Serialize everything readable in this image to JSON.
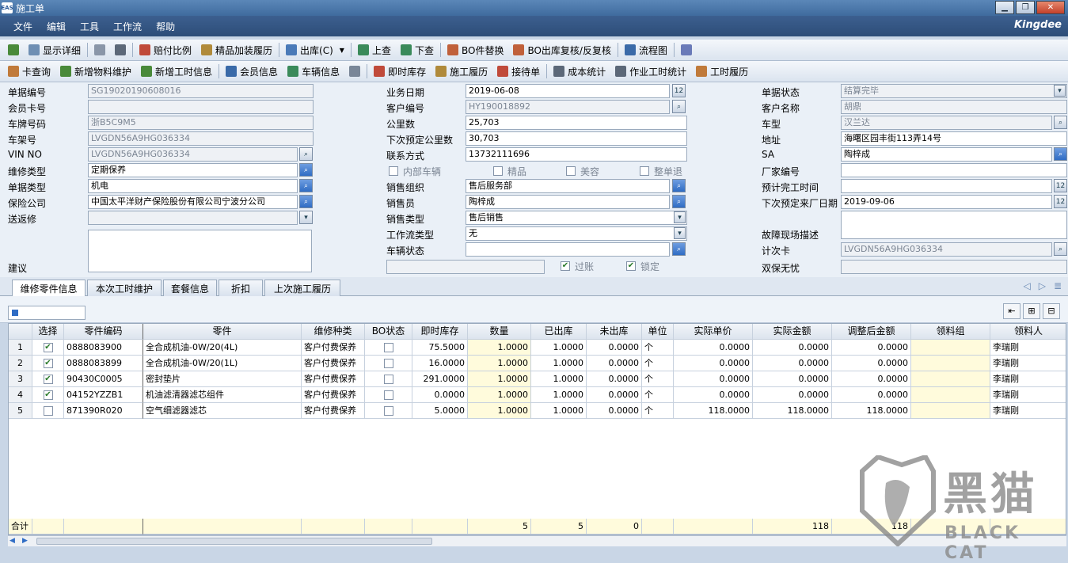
{
  "window": {
    "title": "施工单",
    "app_icon": "EAS",
    "controls": [
      "minimize-icon",
      "restore-icon",
      "close-icon"
    ]
  },
  "menu": [
    "文件",
    "编辑",
    "工具",
    "工作流",
    "帮助"
  ],
  "brand": "Kingdee",
  "toolbar1": [
    "显示详细",
    "赔付比例",
    "精品加装履历",
    "出库(C)",
    "上查",
    "下查",
    "BO件替换",
    "BO出库复核/反复核",
    "流程图"
  ],
  "toolbar2": [
    "卡查询",
    "新增物料维护",
    "新增工时信息",
    "会员信息",
    "车辆信息",
    "即时库存",
    "施工履历",
    "接待单",
    "成本统计",
    "作业工时统计",
    "工时履历"
  ],
  "form": {
    "left": [
      {
        "label": "单据编号",
        "value": "SG19020190608016"
      },
      {
        "label": "会员卡号",
        "value": ""
      },
      {
        "label": "车牌号码",
        "value": "浙B5C9M5"
      },
      {
        "label": "车架号",
        "value": "LVGDN56A9HG036334"
      },
      {
        "label": "VIN NO",
        "value": "LVGDN56A9HG036334"
      },
      {
        "label": "维修类型",
        "value": "定期保养"
      },
      {
        "label": "单据类型",
        "value": "机电"
      },
      {
        "label": "保险公司",
        "value": "中国太平洋财产保险股份有限公司宁波分公司"
      },
      {
        "label": "送返修",
        "value": ""
      },
      {
        "label": "建议",
        "value": ""
      }
    ],
    "middle": [
      {
        "label": "业务日期",
        "value": "2019-06-08"
      },
      {
        "label": "客户编号",
        "value": "HY190018892"
      },
      {
        "label": "公里数",
        "value": "25,703"
      },
      {
        "label": "下次预定公里数",
        "value": "30,703"
      },
      {
        "label": "联系方式",
        "value": "13732111696"
      },
      {
        "label": "销售组织",
        "value": "售后服务部"
      },
      {
        "label": "销售员",
        "value": "陶梓成"
      },
      {
        "label": "销售类型",
        "value": "售后销售"
      },
      {
        "label": "工作流类型",
        "value": "无"
      },
      {
        "label": "车辆状态",
        "value": ""
      }
    ],
    "checks1": [
      {
        "label": "内部车辆",
        "checked": false
      },
      {
        "label": "精品",
        "checked": false
      },
      {
        "label": "美容",
        "checked": false
      },
      {
        "label": "整单退",
        "checked": false
      }
    ],
    "checks2": [
      {
        "label": "过账",
        "checked": true
      },
      {
        "label": "锁定",
        "checked": true
      }
    ],
    "right": [
      {
        "label": "单据状态",
        "value": "结算完毕"
      },
      {
        "label": "客户名称",
        "value": "胡鼎"
      },
      {
        "label": "车型",
        "value": "汉兰达"
      },
      {
        "label": "地址",
        "value": "海曙区园丰街113弄14号"
      },
      {
        "label": "SA",
        "value": "陶梓成"
      },
      {
        "label": "厂家编号",
        "value": ""
      },
      {
        "label": "预计完工时间",
        "value": ""
      },
      {
        "label": "下次预定来厂日期",
        "value": "2019-09-06"
      },
      {
        "label": "故障现场描述",
        "value": ""
      },
      {
        "label": "计次卡",
        "value": "LVGDN56A9HG036334"
      },
      {
        "label": "双保无忧",
        "value": ""
      }
    ]
  },
  "tabs": [
    "维修零件信息",
    "本次工时维护",
    "套餐信息",
    "折扣",
    "上次施工履历"
  ],
  "grid": {
    "columns": [
      "选择",
      "零件编码",
      "零件",
      "维修种类",
      "BO状态",
      "即时库存",
      "数量",
      "已出库",
      "未出库",
      "单位",
      "实际单价",
      "实际金额",
      "调整后金额",
      "领料组",
      "领料人"
    ],
    "rows": [
      {
        "n": "1",
        "sel": true,
        "code": "0888083900",
        "part": "全合成机油-0W/20(4L)",
        "type": "客户付费保养",
        "bo": false,
        "stock": "75.5000",
        "qty": "1.0000",
        "out": "1.0000",
        "notout": "0.0000",
        "unit": "个",
        "price": "0.0000",
        "amount": "0.0000",
        "adj": "0.0000",
        "group": "",
        "person": "李瑞刚"
      },
      {
        "n": "2",
        "sel": true,
        "code": "0888083899",
        "part": "全合成机油-0W/20(1L)",
        "type": "客户付费保养",
        "bo": false,
        "stock": "16.0000",
        "qty": "1.0000",
        "out": "1.0000",
        "notout": "0.0000",
        "unit": "个",
        "price": "0.0000",
        "amount": "0.0000",
        "adj": "0.0000",
        "group": "",
        "person": "李瑞刚"
      },
      {
        "n": "3",
        "sel": true,
        "code": "90430C0005",
        "part": "密封垫片",
        "type": "客户付费保养",
        "bo": false,
        "stock": "291.0000",
        "qty": "1.0000",
        "out": "1.0000",
        "notout": "0.0000",
        "unit": "个",
        "price": "0.0000",
        "amount": "0.0000",
        "adj": "0.0000",
        "group": "",
        "person": "李瑞刚"
      },
      {
        "n": "4",
        "sel": true,
        "code": "04152YZZB1",
        "part": "机油滤清器滤芯组件",
        "type": "客户付费保养",
        "bo": false,
        "stock": "0.0000",
        "qty": "1.0000",
        "out": "1.0000",
        "notout": "0.0000",
        "unit": "个",
        "price": "0.0000",
        "amount": "0.0000",
        "adj": "0.0000",
        "group": "",
        "person": "李瑞刚"
      },
      {
        "n": "5",
        "sel": false,
        "code": "871390R020",
        "part": "空气细滤器滤芯",
        "type": "客户付费保养",
        "bo": false,
        "stock": "5.0000",
        "qty": "1.0000",
        "out": "1.0000",
        "notout": "0.0000",
        "unit": "个",
        "price": "118.0000",
        "amount": "118.0000",
        "adj": "118.0000",
        "group": "",
        "person": "李瑞刚"
      }
    ],
    "totals": {
      "label": "合计",
      "qty": "5",
      "out": "5",
      "notout": "0",
      "amount": "118",
      "adj": "118"
    }
  },
  "watermark": {
    "text1": "黑猫",
    "text2": "BLACK CAT"
  }
}
